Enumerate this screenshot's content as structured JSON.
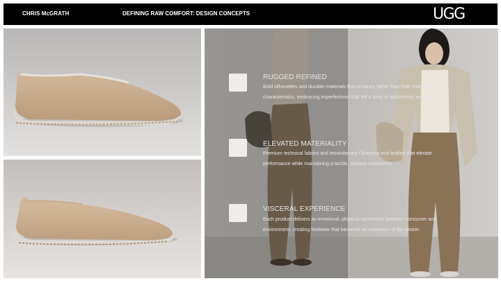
{
  "header": {
    "author": "CHRIS McGRATH",
    "title": "DEFINING RAW COMFORT: DESIGN CONCEPTS",
    "logo": "UGG"
  },
  "concepts": [
    {
      "title": "RUGGED REFINED",
      "body": "Bold silhouettes and durable materials that enhance rather than hide their natural characteristics, embracing imperfections that tell a story of authenticity and strength."
    },
    {
      "title": "ELEVATED MATERIALITY",
      "body": "Premium technical fabrics and revolutionary Dyneema eco-leather that elevate performance while maintaining a tactile, sensory experience."
    },
    {
      "title": "VISCERAL EXPERIENCE",
      "body": "Each product delivers an emotional, physical connection between consumer and environment, creating footwear that becomes an extension of the wearer."
    }
  ],
  "colors": {
    "header_bg": "#000000",
    "shoe_tan": "#c9ad8f",
    "trouser_olive": "#8a7256",
    "jacket_stone": "#c8bfae"
  },
  "icons": [
    "checkbox-icon"
  ]
}
